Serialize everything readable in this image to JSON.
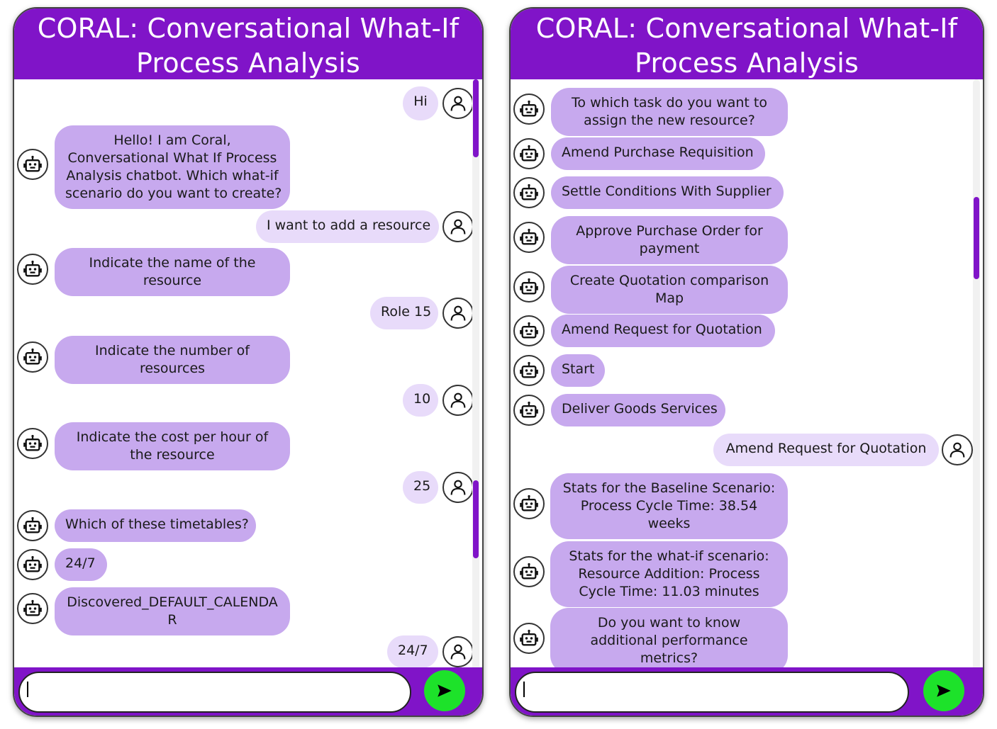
{
  "left_panel": {
    "title_line1": "CORAL: Conversational What-If",
    "title_line2": "Process Analysis",
    "messages": [
      {
        "from": "user",
        "text": "Hi"
      },
      {
        "from": "bot",
        "lines": [
          "Hello! I am Coral,",
          "Conversational What If Process",
          "Analysis chatbot. Which what-if",
          "scenario do you want to create?"
        ]
      },
      {
        "from": "user",
        "text": "I want to add a resource"
      },
      {
        "from": "bot",
        "lines": [
          "Indicate the name of the",
          "resource"
        ]
      },
      {
        "from": "user",
        "text": "Role 15"
      },
      {
        "from": "bot",
        "lines": [
          "Indicate the number of",
          "resources"
        ]
      },
      {
        "from": "user",
        "text": "10"
      },
      {
        "from": "bot",
        "lines": [
          "Indicate the cost per hour of",
          "the resource"
        ]
      },
      {
        "from": "user",
        "text": "25"
      },
      {
        "from": "bot",
        "lines": [
          "Which of these timetables?"
        ]
      },
      {
        "from": "bot",
        "lines": [
          "24/7"
        ]
      },
      {
        "from": "bot",
        "lines": [
          "Discovered_DEFAULT_CALENDA",
          "R"
        ]
      },
      {
        "from": "user",
        "text": "24/7"
      }
    ],
    "input_value": ""
  },
  "right_panel": {
    "title_line1": "CORAL: Conversational What-If",
    "title_line2": "Process Analysis",
    "messages": [
      {
        "from": "bot",
        "lines": [
          "To which task do you want to",
          "assign the new resource?"
        ]
      },
      {
        "from": "bot",
        "lines": [
          "Amend Purchase Requisition"
        ]
      },
      {
        "from": "bot",
        "lines": [
          "Settle Conditions With Supplier"
        ]
      },
      {
        "from": "bot",
        "lines": [
          "Approve Purchase Order for",
          "payment"
        ]
      },
      {
        "from": "bot",
        "lines": [
          "Create Quotation comparison",
          "Map"
        ]
      },
      {
        "from": "bot",
        "lines": [
          "Amend Request for Quotation"
        ]
      },
      {
        "from": "bot",
        "lines": [
          "Start"
        ]
      },
      {
        "from": "bot",
        "lines": [
          "Deliver Goods Services"
        ]
      },
      {
        "from": "user",
        "text": "Amend Request for Quotation"
      },
      {
        "from": "bot",
        "lines": [
          "Stats for the Baseline Scenario:",
          "Process Cycle Time: 38.54",
          "weeks"
        ]
      },
      {
        "from": "bot",
        "lines": [
          "Stats for the what-if scenario:",
          "Resource Addition: Process",
          "Cycle Time: 11.03 minutes"
        ]
      },
      {
        "from": "bot",
        "lines": [
          "Do you want to know",
          "additional performance",
          "metrics?"
        ]
      }
    ],
    "input_value": ""
  },
  "icons": {
    "bot": "robot-icon",
    "user": "user-icon",
    "send": "send-arrow-icon"
  },
  "colors": {
    "header": "#8014c8",
    "bot_bubble": "#c7a9ee",
    "user_bubble": "#e8dbfa",
    "send_button": "#1de22a"
  }
}
